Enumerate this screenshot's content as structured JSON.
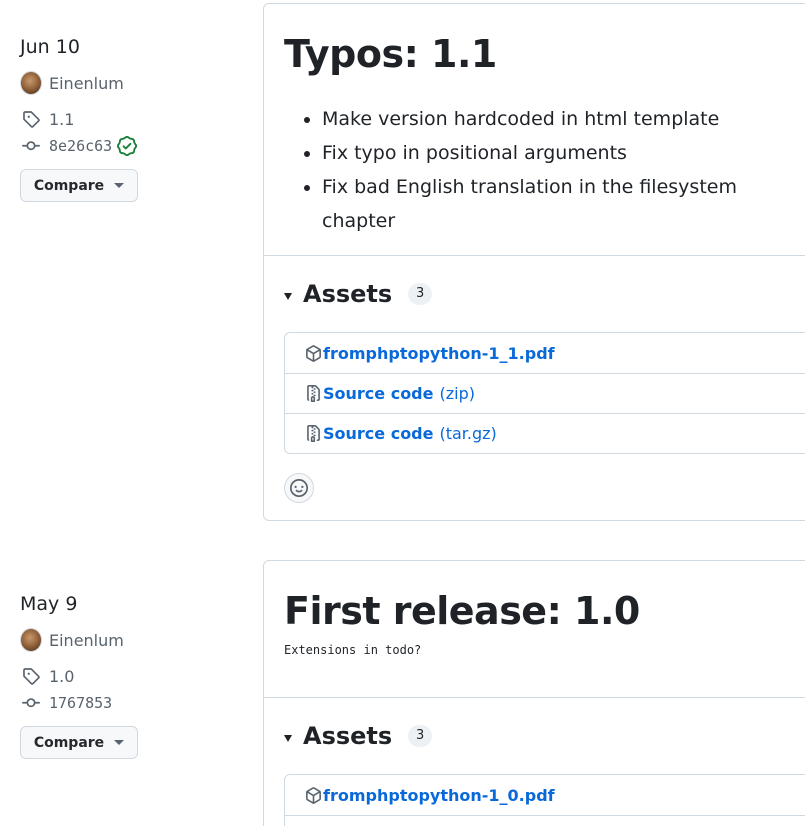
{
  "releases": [
    {
      "date": "Jun 10",
      "author": "Einenlum",
      "tag": "1.1",
      "commit": "8e26c63",
      "compare_label": "Compare",
      "title": "Typos: 1.1",
      "notes": [
        "Make version hardcoded in html template",
        "Fix typo in positional arguments",
        "Fix bad English translation in the filesystem chapter"
      ],
      "assets_label": "Assets",
      "assets_count": "3",
      "assets": [
        {
          "name": "fromphptopython-1_1.pdf",
          "format": "",
          "icon": "package-icon"
        },
        {
          "name": "Source code",
          "format": "(zip)",
          "icon": "file-zip-icon"
        },
        {
          "name": "Source code",
          "format": "(tar.gz)",
          "icon": "file-zip-icon"
        }
      ]
    },
    {
      "date": "May 9",
      "author": "Einenlum",
      "tag": "1.0",
      "commit": "1767853",
      "compare_label": "Compare",
      "title": "First release: 1.0",
      "body": "Extensions in todo?",
      "assets_label": "Assets",
      "assets_count": "3",
      "assets": [
        {
          "name": "fromphptopython-1_0.pdf",
          "format": "",
          "icon": "package-icon"
        }
      ]
    }
  ],
  "colors": {
    "link": "#0969da",
    "verified": "#1a7f37",
    "border": "#d1d9e0"
  }
}
